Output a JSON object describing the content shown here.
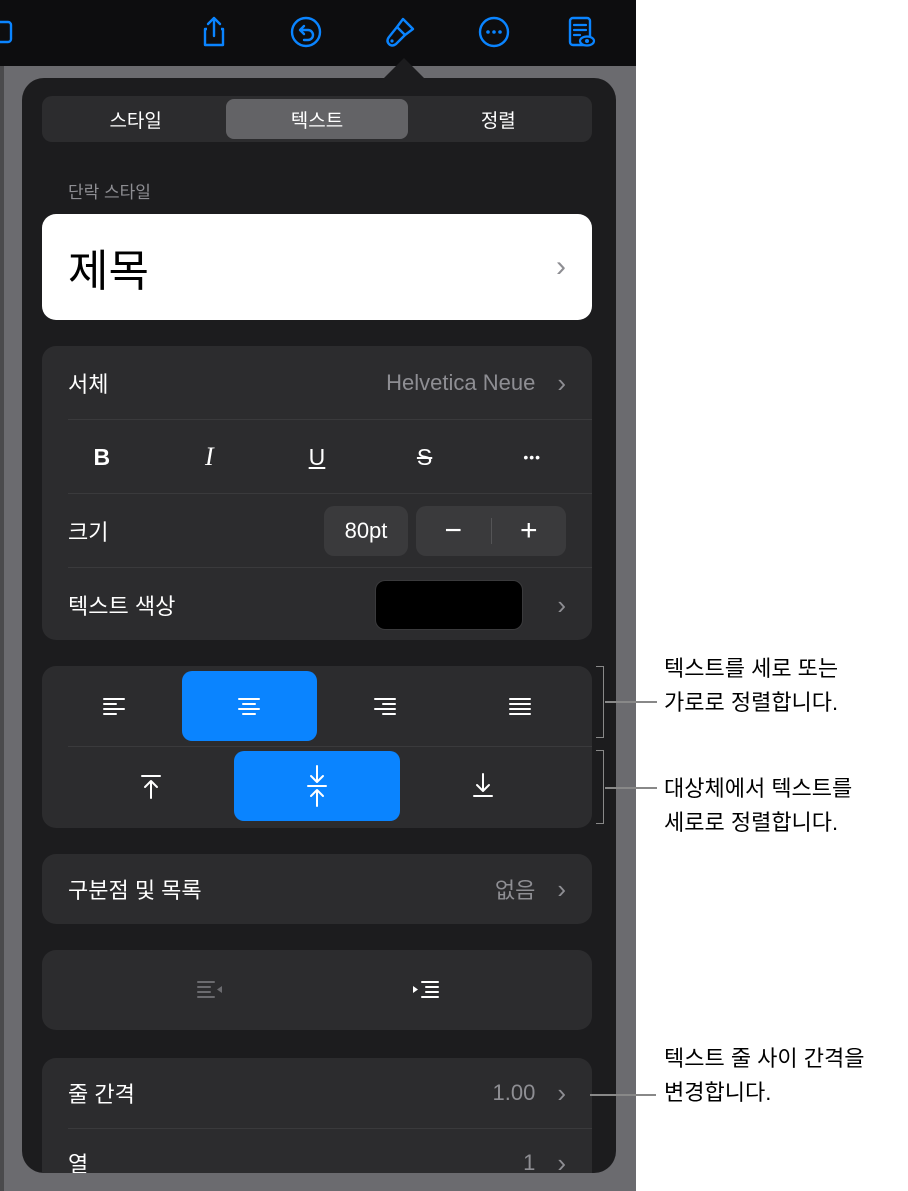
{
  "toolbar": {
    "icons": [
      "photo-icon",
      "share-icon",
      "undo-icon",
      "format-brush-icon",
      "more-icon",
      "reader-view-icon"
    ]
  },
  "tabs": [
    {
      "label": "스타일",
      "active": false
    },
    {
      "label": "텍스트",
      "active": true
    },
    {
      "label": "정렬",
      "active": false
    }
  ],
  "paragraph_style": {
    "section_label": "단락 스타일",
    "value": "제목"
  },
  "font": {
    "label": "서체",
    "value": "Helvetica Neue",
    "format_buttons": [
      "B",
      "I",
      "U",
      "S",
      "•••"
    ]
  },
  "size": {
    "label": "크기",
    "value": "80pt",
    "minus": "−",
    "plus": "+"
  },
  "text_color": {
    "label": "텍스트 색상",
    "swatch": "#000000"
  },
  "alignment": {
    "horizontal_active": "center",
    "vertical_active": "middle"
  },
  "bullets": {
    "label": "구분점 및 목록",
    "value": "없음"
  },
  "line_spacing": {
    "label": "줄 간격",
    "value": "1.00"
  },
  "columns": {
    "label": "열",
    "value": "1"
  },
  "callouts": {
    "align_line1": "텍스트를 세로 또는",
    "align_line2": "가로로 정렬합니다.",
    "valign_line1": "대상체에서 텍스트를",
    "valign_line2": "세로로 정렬합니다.",
    "spacing_line1": "텍스트 줄 사이 간격을",
    "spacing_line2": "변경합니다."
  },
  "colors": {
    "accent": "#0a84ff",
    "panel": "#1c1c1e",
    "group": "#2c2c2e"
  }
}
